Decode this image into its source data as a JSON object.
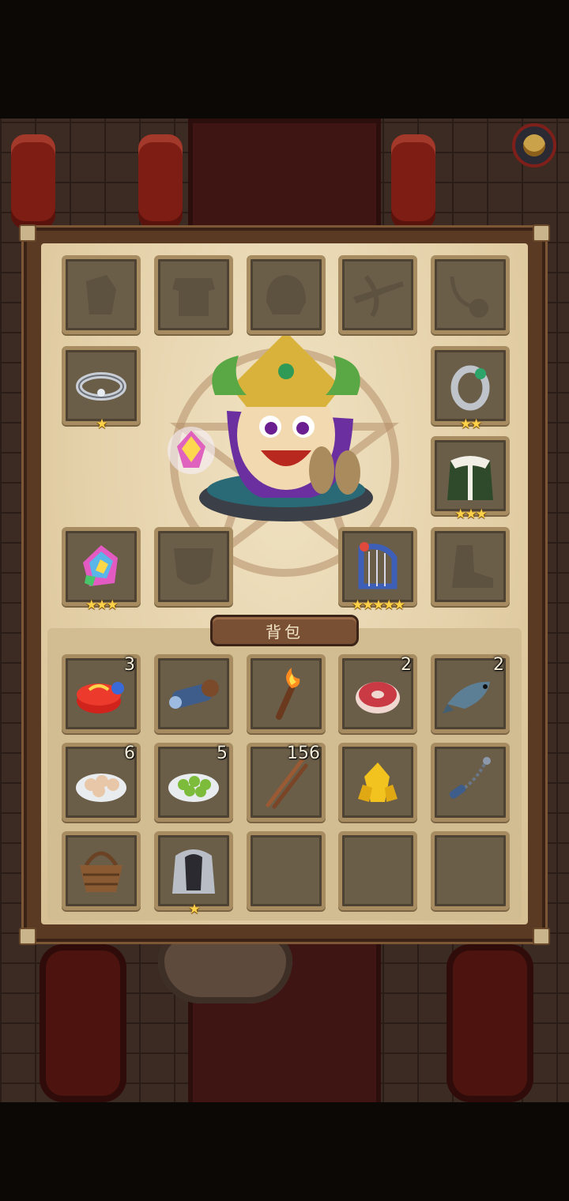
{
  "equipment": {
    "slots": [
      {
        "name": "gloves-slot",
        "icon": "gloves-icon",
        "empty": true
      },
      {
        "name": "armor-slot",
        "icon": "armor-icon",
        "empty": true
      },
      {
        "name": "helmet-slot",
        "icon": "helmet-icon",
        "empty": true
      },
      {
        "name": "crossbow-slot",
        "icon": "crossbow-icon",
        "empty": true
      },
      {
        "name": "necklace-slot",
        "icon": "necklace-icon",
        "empty": true
      },
      {
        "name": "ring-left-slot",
        "icon": "silver-ring-icon",
        "stars": "★"
      },
      {
        "name": "ring-right-slot",
        "icon": "emerald-ring-icon",
        "stars": "★★"
      },
      {
        "name": "cloak-slot",
        "icon": "fur-cloak-icon",
        "stars": "★★★"
      },
      {
        "name": "gem-slot",
        "icon": "rainbow-crystal-icon",
        "stars": "★★★"
      },
      {
        "name": "mask-slot",
        "icon": "mask-icon",
        "empty": true
      },
      {
        "name": "harp-slot",
        "icon": "harp-icon",
        "stars": "★★★★★"
      },
      {
        "name": "boots-slot",
        "icon": "boots-icon",
        "empty": true
      }
    ]
  },
  "bag": {
    "title": "背包",
    "items": [
      {
        "name": "gift-box",
        "icon": "gift-box-icon",
        "count": "3"
      },
      {
        "name": "cannon",
        "icon": "cannon-icon",
        "count": ""
      },
      {
        "name": "torch",
        "icon": "torch-icon",
        "count": ""
      },
      {
        "name": "meat",
        "icon": "meat-icon",
        "count": "2"
      },
      {
        "name": "fish",
        "icon": "fish-icon",
        "count": "2"
      },
      {
        "name": "dumplings",
        "icon": "dumplings-icon",
        "count": "6"
      },
      {
        "name": "green-beans",
        "icon": "green-beans-icon",
        "count": "5"
      },
      {
        "name": "sticks",
        "icon": "sticks-icon",
        "count": "156"
      },
      {
        "name": "gold-crystal",
        "icon": "gold-crystal-icon",
        "count": ""
      },
      {
        "name": "chain-flail",
        "icon": "chain-flail-icon",
        "count": ""
      },
      {
        "name": "basket",
        "icon": "basket-icon",
        "count": ""
      },
      {
        "name": "cloak-armor",
        "icon": "cloak-armor-icon",
        "count": "",
        "stars": "★"
      },
      {
        "name": "empty-1",
        "icon": "",
        "count": ""
      },
      {
        "name": "empty-2",
        "icon": "",
        "count": ""
      },
      {
        "name": "empty-3",
        "icon": "",
        "count": ""
      }
    ]
  },
  "colors": {
    "panel_bg": "#e4d0a8",
    "slot_bg": "#6b5e49",
    "slot_border": "#a78c61",
    "star": "#ffd24a"
  }
}
